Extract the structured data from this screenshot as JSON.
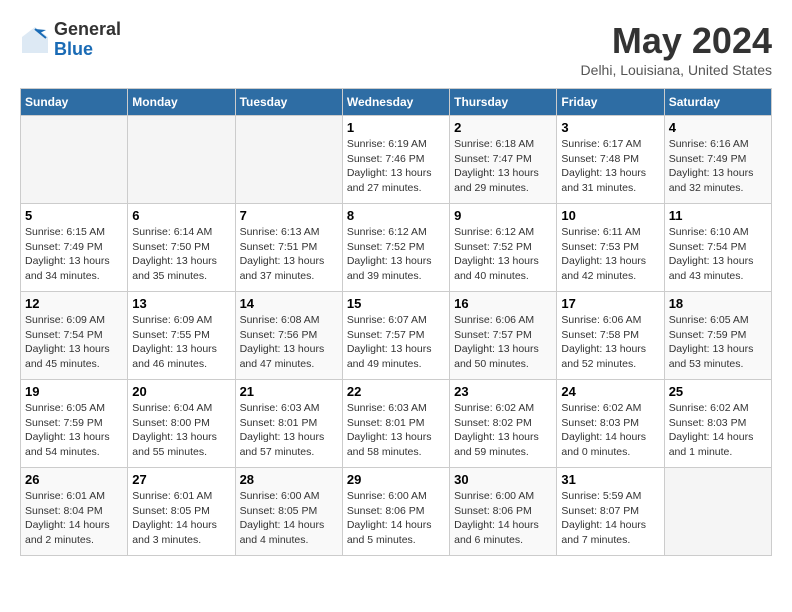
{
  "logo": {
    "general": "General",
    "blue": "Blue"
  },
  "title": {
    "month_year": "May 2024",
    "location": "Delhi, Louisiana, United States"
  },
  "weekdays": [
    "Sunday",
    "Monday",
    "Tuesday",
    "Wednesday",
    "Thursday",
    "Friday",
    "Saturday"
  ],
  "weeks": [
    [
      {
        "day": "",
        "info": ""
      },
      {
        "day": "",
        "info": ""
      },
      {
        "day": "",
        "info": ""
      },
      {
        "day": "1",
        "info": "Sunrise: 6:19 AM\nSunset: 7:46 PM\nDaylight: 13 hours\nand 27 minutes."
      },
      {
        "day": "2",
        "info": "Sunrise: 6:18 AM\nSunset: 7:47 PM\nDaylight: 13 hours\nand 29 minutes."
      },
      {
        "day": "3",
        "info": "Sunrise: 6:17 AM\nSunset: 7:48 PM\nDaylight: 13 hours\nand 31 minutes."
      },
      {
        "day": "4",
        "info": "Sunrise: 6:16 AM\nSunset: 7:49 PM\nDaylight: 13 hours\nand 32 minutes."
      }
    ],
    [
      {
        "day": "5",
        "info": "Sunrise: 6:15 AM\nSunset: 7:49 PM\nDaylight: 13 hours\nand 34 minutes."
      },
      {
        "day": "6",
        "info": "Sunrise: 6:14 AM\nSunset: 7:50 PM\nDaylight: 13 hours\nand 35 minutes."
      },
      {
        "day": "7",
        "info": "Sunrise: 6:13 AM\nSunset: 7:51 PM\nDaylight: 13 hours\nand 37 minutes."
      },
      {
        "day": "8",
        "info": "Sunrise: 6:12 AM\nSunset: 7:52 PM\nDaylight: 13 hours\nand 39 minutes."
      },
      {
        "day": "9",
        "info": "Sunrise: 6:12 AM\nSunset: 7:52 PM\nDaylight: 13 hours\nand 40 minutes."
      },
      {
        "day": "10",
        "info": "Sunrise: 6:11 AM\nSunset: 7:53 PM\nDaylight: 13 hours\nand 42 minutes."
      },
      {
        "day": "11",
        "info": "Sunrise: 6:10 AM\nSunset: 7:54 PM\nDaylight: 13 hours\nand 43 minutes."
      }
    ],
    [
      {
        "day": "12",
        "info": "Sunrise: 6:09 AM\nSunset: 7:54 PM\nDaylight: 13 hours\nand 45 minutes."
      },
      {
        "day": "13",
        "info": "Sunrise: 6:09 AM\nSunset: 7:55 PM\nDaylight: 13 hours\nand 46 minutes."
      },
      {
        "day": "14",
        "info": "Sunrise: 6:08 AM\nSunset: 7:56 PM\nDaylight: 13 hours\nand 47 minutes."
      },
      {
        "day": "15",
        "info": "Sunrise: 6:07 AM\nSunset: 7:57 PM\nDaylight: 13 hours\nand 49 minutes."
      },
      {
        "day": "16",
        "info": "Sunrise: 6:06 AM\nSunset: 7:57 PM\nDaylight: 13 hours\nand 50 minutes."
      },
      {
        "day": "17",
        "info": "Sunrise: 6:06 AM\nSunset: 7:58 PM\nDaylight: 13 hours\nand 52 minutes."
      },
      {
        "day": "18",
        "info": "Sunrise: 6:05 AM\nSunset: 7:59 PM\nDaylight: 13 hours\nand 53 minutes."
      }
    ],
    [
      {
        "day": "19",
        "info": "Sunrise: 6:05 AM\nSunset: 7:59 PM\nDaylight: 13 hours\nand 54 minutes."
      },
      {
        "day": "20",
        "info": "Sunrise: 6:04 AM\nSunset: 8:00 PM\nDaylight: 13 hours\nand 55 minutes."
      },
      {
        "day": "21",
        "info": "Sunrise: 6:03 AM\nSunset: 8:01 PM\nDaylight: 13 hours\nand 57 minutes."
      },
      {
        "day": "22",
        "info": "Sunrise: 6:03 AM\nSunset: 8:01 PM\nDaylight: 13 hours\nand 58 minutes."
      },
      {
        "day": "23",
        "info": "Sunrise: 6:02 AM\nSunset: 8:02 PM\nDaylight: 13 hours\nand 59 minutes."
      },
      {
        "day": "24",
        "info": "Sunrise: 6:02 AM\nSunset: 8:03 PM\nDaylight: 14 hours\nand 0 minutes."
      },
      {
        "day": "25",
        "info": "Sunrise: 6:02 AM\nSunset: 8:03 PM\nDaylight: 14 hours\nand 1 minute."
      }
    ],
    [
      {
        "day": "26",
        "info": "Sunrise: 6:01 AM\nSunset: 8:04 PM\nDaylight: 14 hours\nand 2 minutes."
      },
      {
        "day": "27",
        "info": "Sunrise: 6:01 AM\nSunset: 8:05 PM\nDaylight: 14 hours\nand 3 minutes."
      },
      {
        "day": "28",
        "info": "Sunrise: 6:00 AM\nSunset: 8:05 PM\nDaylight: 14 hours\nand 4 minutes."
      },
      {
        "day": "29",
        "info": "Sunrise: 6:00 AM\nSunset: 8:06 PM\nDaylight: 14 hours\nand 5 minutes."
      },
      {
        "day": "30",
        "info": "Sunrise: 6:00 AM\nSunset: 8:06 PM\nDaylight: 14 hours\nand 6 minutes."
      },
      {
        "day": "31",
        "info": "Sunrise: 5:59 AM\nSunset: 8:07 PM\nDaylight: 14 hours\nand 7 minutes."
      },
      {
        "day": "",
        "info": ""
      }
    ]
  ]
}
